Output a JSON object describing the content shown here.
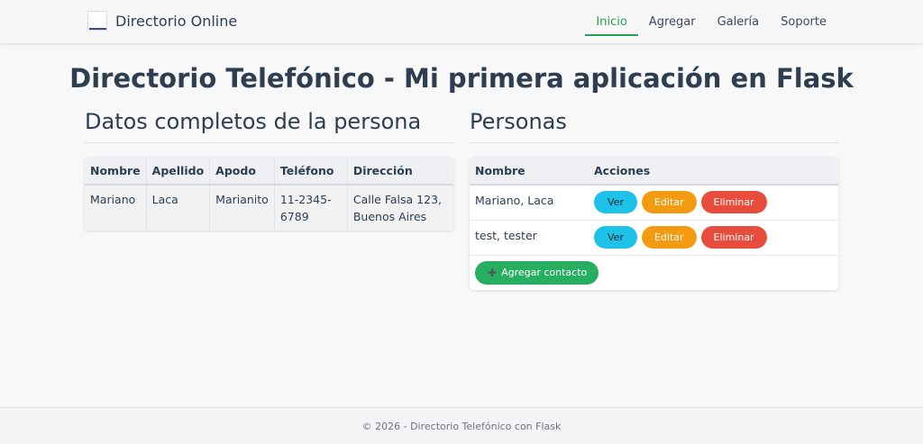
{
  "navbar": {
    "brand": "Directorio Online",
    "links": [
      "Inicio",
      "Agregar",
      "Galería",
      "Soporte"
    ],
    "active": "Inicio"
  },
  "main_title": "Directorio Telefónico - Mi primera aplicación en Flask",
  "details": {
    "title": "Datos completos de la persona",
    "columns": [
      "Nombre",
      "Apellido",
      "Apodo",
      "Teléfono",
      "Dirección"
    ],
    "row": [
      "Mariano",
      "Laca",
      "Marianito",
      "11-2345-6789",
      "Calle Falsa 123, Buenos Aires"
    ]
  },
  "people": {
    "title": "Personas",
    "columns": [
      "Nombre",
      "Acciones"
    ],
    "rows": [
      {
        "name": "Mariano, Laca"
      },
      {
        "name": "test, tester"
      }
    ],
    "actions": {
      "view": "Ver",
      "edit": "Editar",
      "delete": "Eliminar"
    },
    "add_label": "Agregar contacto"
  },
  "footer": "© 2026 - Directorio Telefónico con Flask",
  "colors": {
    "accent": "#27a055",
    "view": "#1ec2e8",
    "edit": "#f39c12",
    "delete": "#e74c3c",
    "add": "#27ae60"
  },
  "icons": {
    "brand": "directory-logo-icon",
    "add": "plus-icon"
  }
}
